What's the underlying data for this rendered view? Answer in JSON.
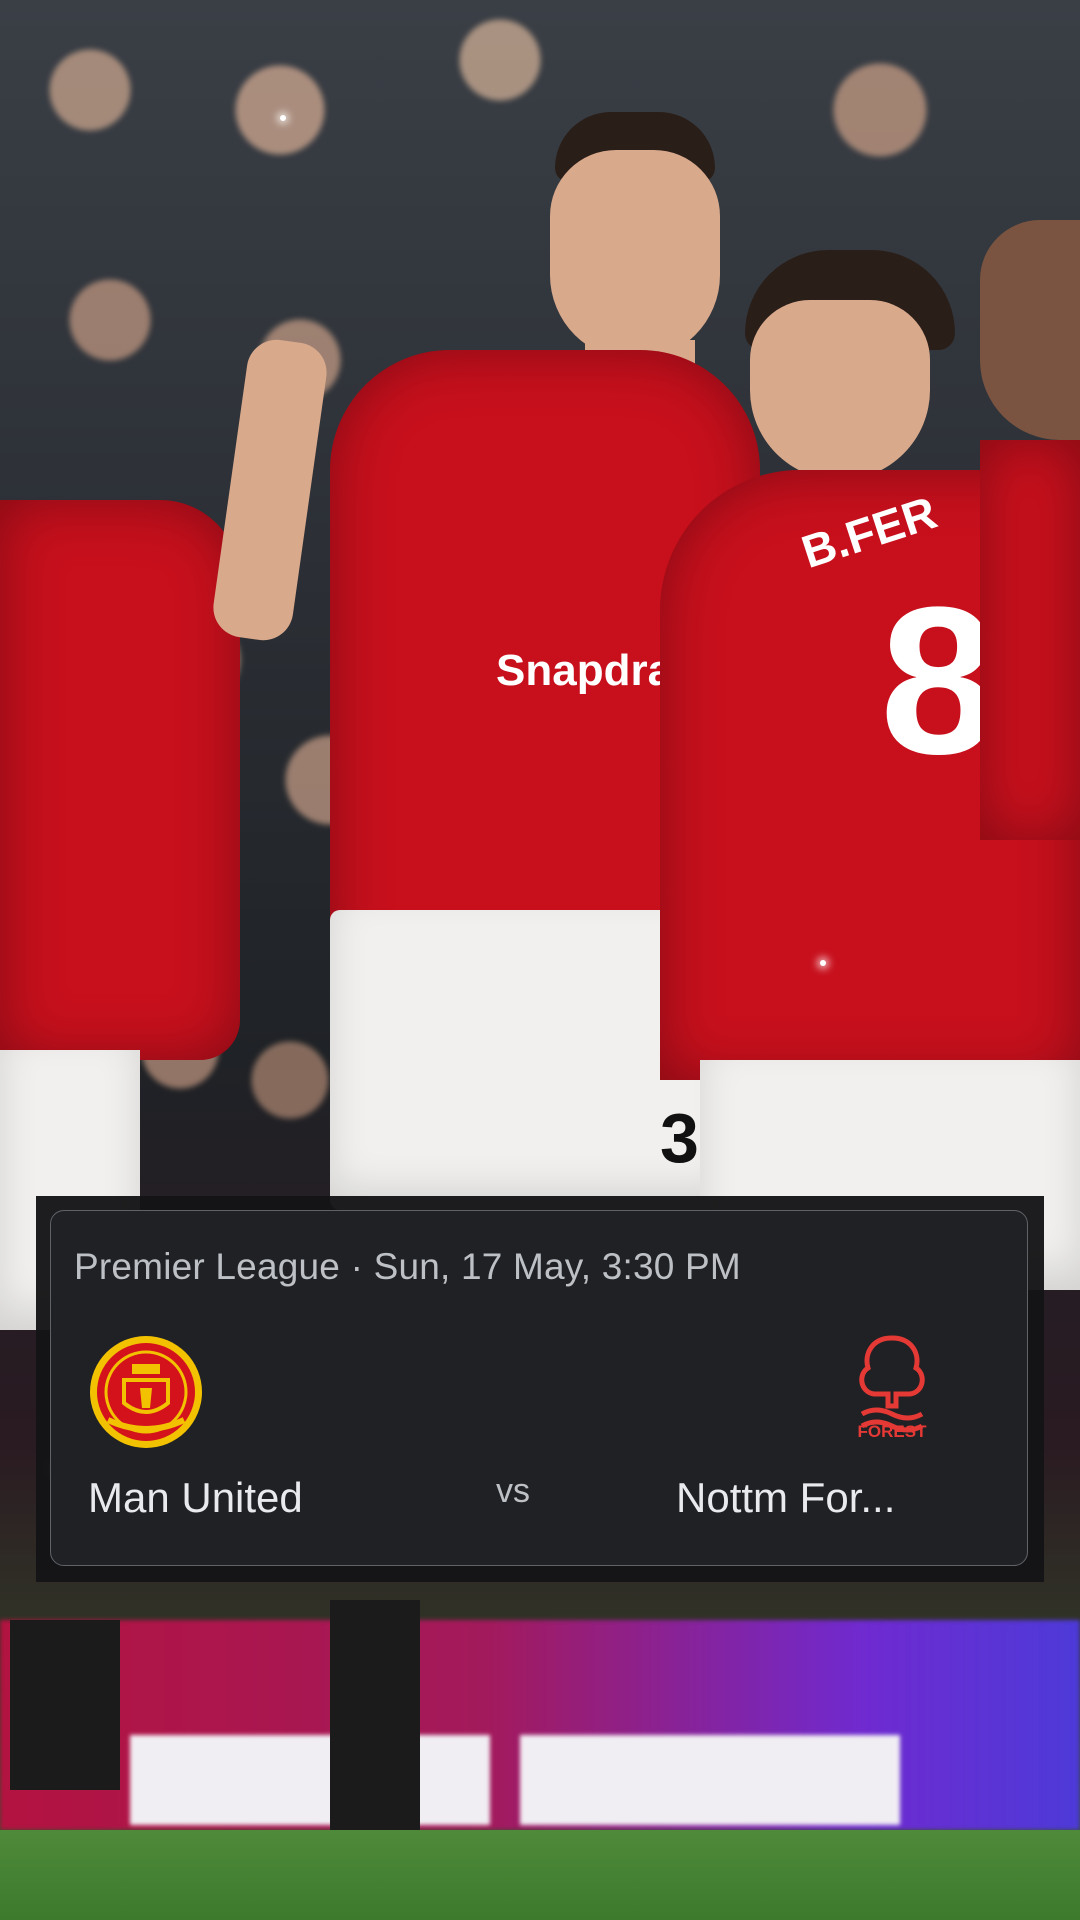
{
  "photo": {
    "description_icon": "football-celebration-photo",
    "jersey_sponsor": "Snapdragon",
    "player_name_on_back": "B.FER",
    "player_number": "8",
    "shorts_number": "3"
  },
  "match_card": {
    "competition": "Premier League",
    "separator": "·",
    "datetime": "Sun, 17 May, 3:30 PM",
    "home_team": {
      "name": "Man United",
      "crest_icon": "manchester-united-crest-icon"
    },
    "vs_label": "vs",
    "away_team": {
      "name": "Nottm For...",
      "crest_icon": "nottingham-forest-crest-icon",
      "crest_text": "FOREST"
    }
  },
  "colors": {
    "card_bg": "#202124",
    "card_border": "#5f6368",
    "meta_text": "#bdc1c6",
    "team_text": "#e8eaed",
    "united_red": "#c8101d",
    "forest_red": "#e53935"
  }
}
